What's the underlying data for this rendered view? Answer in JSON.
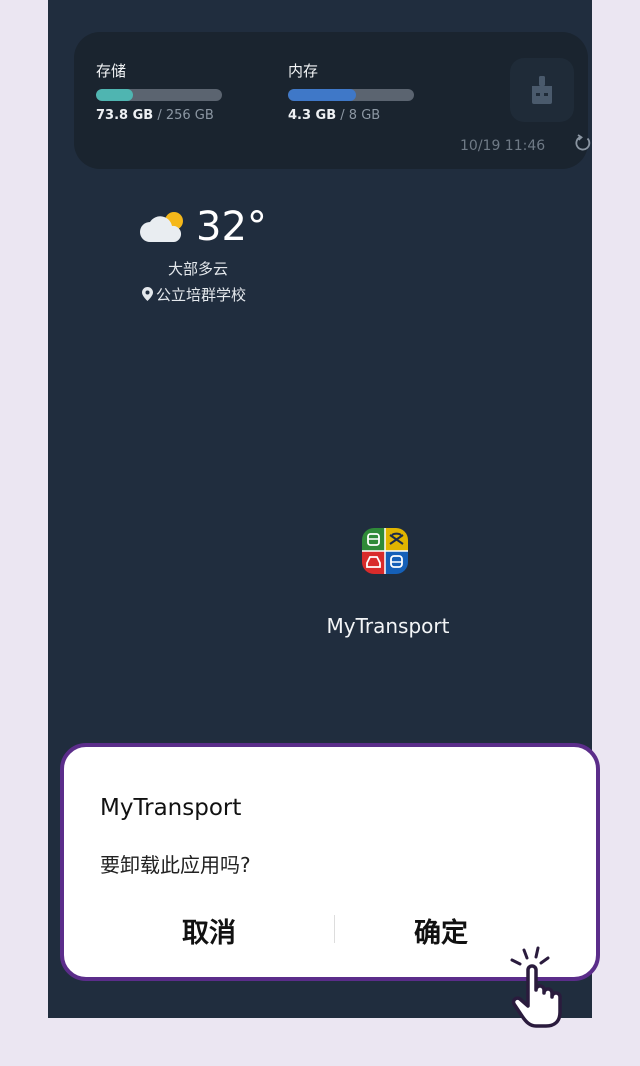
{
  "widget": {
    "storage": {
      "label": "存储",
      "used": "73.8 GB",
      "total": " / 256 GB",
      "fill_color": "#4fb5b1",
      "fraction": 0.29
    },
    "memory": {
      "label": "内存",
      "used": "4.3 GB",
      "total": " / 8 GB",
      "fill_color": "#3f78c8",
      "fraction": 0.54
    },
    "timestamp": "10/19 11:46",
    "icons": {
      "clean": "broom-icon",
      "refresh": "refresh-icon"
    }
  },
  "weather": {
    "temperature": "32°",
    "condition": "大部多云",
    "location": "公立培群学校",
    "icons": {
      "weather": "partly-cloudy-icon",
      "location": "location-pin-icon"
    }
  },
  "app": {
    "label": "MyTransport",
    "icon": "mytransport-app-icon",
    "quadrant_colors": [
      "#2f8a38",
      "#e0b400",
      "#d92b2b",
      "#1560b8"
    ]
  },
  "dialog": {
    "title": "MyTransport",
    "message": "要卸载此应用吗?",
    "cancel_label": "取消",
    "confirm_label": "确定",
    "highlight_color": "#5b2d8a"
  },
  "pointer": {
    "icon": "tap-hand-icon"
  }
}
